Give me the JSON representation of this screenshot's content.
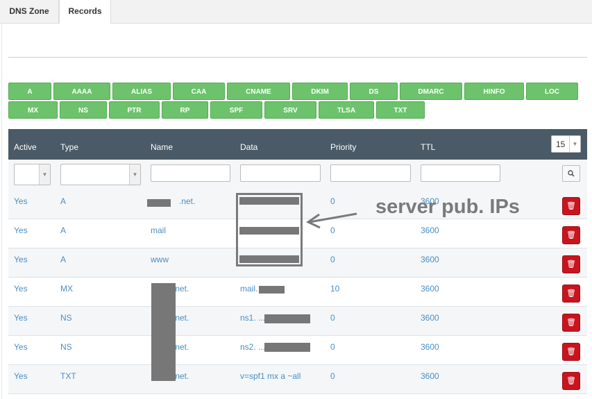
{
  "tabs": [
    {
      "label": "DNS Zone"
    },
    {
      "label": "Records"
    }
  ],
  "record_types": [
    "A",
    "AAAA",
    "ALIAS",
    "CAA",
    "CNAME",
    "DKIM",
    "DS",
    "DMARC",
    "HINFO",
    "LOC",
    "MX",
    "NS",
    "PTR",
    "RP",
    "SPF",
    "SRV",
    "TLSA",
    "TXT"
  ],
  "table": {
    "columns": [
      "Active",
      "Type",
      "Name",
      "Data",
      "Priority",
      "TTL"
    ],
    "page_size": "15",
    "rows": [
      {
        "active": "Yes",
        "type": "A",
        "name": ".net.",
        "data": "",
        "priority": "0",
        "ttl": "3600"
      },
      {
        "active": "Yes",
        "type": "A",
        "name": "mail",
        "data": "",
        "priority": "0",
        "ttl": "3600"
      },
      {
        "active": "Yes",
        "type": "A",
        "name": "www",
        "data": "",
        "priority": "0",
        "ttl": "3600"
      },
      {
        "active": "Yes",
        "type": "MX",
        "name": ".net.",
        "data": "mail.          .net.",
        "priority": "10",
        "ttl": "3600"
      },
      {
        "active": "Yes",
        "type": "NS",
        "name": ".net.",
        "data": "ns1.                    ...",
        "priority": "0",
        "ttl": "3600"
      },
      {
        "active": "Yes",
        "type": "NS",
        "name": ".net.",
        "data": "ns2.                    ...",
        "priority": "0",
        "ttl": "3600"
      },
      {
        "active": "Yes",
        "type": "TXT",
        "name": ".net.",
        "data": "v=spf1 mx a ~all",
        "priority": "0",
        "ttl": "3600"
      }
    ]
  },
  "annotation": {
    "text": "server pub. IPs"
  },
  "icons": {
    "delete": "trash-icon",
    "search": "search-icon",
    "caret": "caret-down-icon"
  },
  "colors": {
    "button_green": "#6cc36c",
    "header_bg": "#4a5a66",
    "delete_red": "#c8141e",
    "link_blue": "#4a8ec2"
  }
}
